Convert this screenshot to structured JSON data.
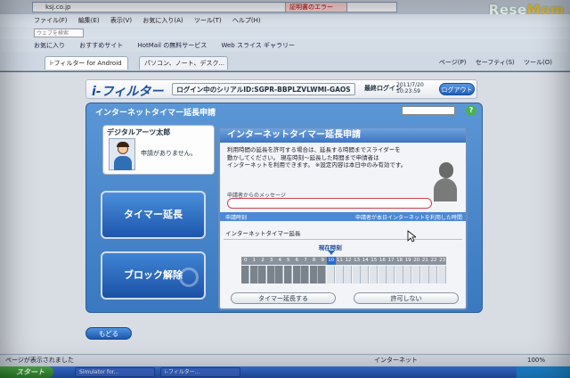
{
  "browser": {
    "address": "ksj.co.jp",
    "cert_error": "証明書のエラー",
    "menu": [
      "ファイル(F)",
      "編集(E)",
      "表示(V)",
      "お気に入り(A)",
      "ツール(T)",
      "ヘルプ(H)"
    ],
    "search_placeholder": "ウェブを検索",
    "favorites": [
      "お気に入り",
      "おすすめサイト",
      "HotMail の無料サービス",
      "Web スライス ギャラリー"
    ],
    "tabs": [
      "i-フィルター for Android",
      "パソコン、ノート、デスク..."
    ],
    "commands": [
      "ページ(P)",
      "セーフティ(S)",
      "ツール(O)"
    ]
  },
  "watermark": {
    "prefix": "Rese",
    "accent": "Mom"
  },
  "header": {
    "logo": "i-フィルター",
    "serial": "ログイン中のシリアルID:SGPR-BBPLZVLWMI-GAOS",
    "last_login_label": "最終ログイン",
    "last_login_date": "2011/7/20",
    "last_login_time": "10:23:59",
    "logout": "ログアウト"
  },
  "panel": {
    "title": "インターネットタイマー延長申請",
    "user_name": "デジタルアーツ太郎",
    "no_request": "申請がありません。",
    "timer_button": "タイマー延長",
    "block_button": "ブロック解除",
    "back_button": "もどる"
  },
  "dialog": {
    "title": "インターネットタイマー延長申請",
    "instruction_1": "利用時間の延長を許可する場合は、延長する時間までスライダーを",
    "instruction_2": "動かしてください。 現在時刻～延長した時間まで申請者は",
    "instruction_3": "インターネットを利用できます。 ※設定内容は本日中のみ有効です。",
    "message_label": "申請者からのメッセージ",
    "request_time_label": "申請時刻",
    "used_time_label": "申請者が本日インターネットを利用した時間",
    "extension_label": "インターネットタイマー延長",
    "current_time_label": "現在時刻",
    "hours": [
      "0",
      "1",
      "2",
      "3",
      "4",
      "5",
      "6",
      "7",
      "8",
      "9",
      "10",
      "11",
      "12",
      "13",
      "14",
      "15",
      "16",
      "17",
      "18",
      "19",
      "20",
      "21",
      "22",
      "23"
    ],
    "current_hour": 10,
    "extend_button": "タイマー延長する",
    "deny_button": "許可しない"
  },
  "status": {
    "text": "ページが表示されました",
    "zone": "インターネット",
    "zoom": "100%"
  },
  "taskbar": {
    "start": "スタート",
    "items": [
      "Simulator for...",
      "i-フィルター..."
    ]
  },
  "colors": {
    "accent": "#3a78c0",
    "used": "#7a828c",
    "available": "#dfe4ea"
  }
}
